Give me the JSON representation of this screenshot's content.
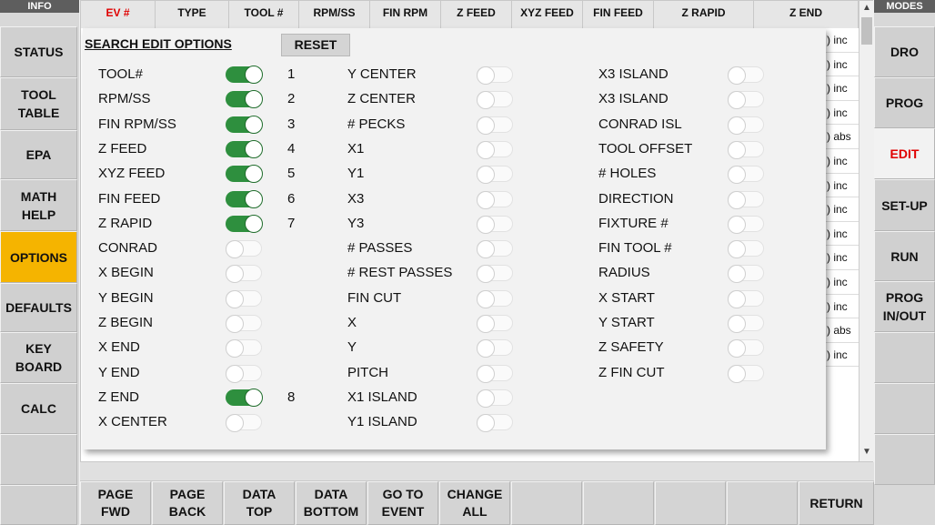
{
  "left_sidebar": {
    "header": "INFO",
    "buttons": [
      "STATUS",
      "TOOL\nTABLE",
      "EPA",
      "MATH\nHELP",
      "OPTIONS",
      "DEFAULTS",
      "KEY\nBOARD",
      "CALC",
      "",
      ""
    ],
    "active": "OPTIONS"
  },
  "right_sidebar": {
    "header": "MODES",
    "buttons": [
      "DRO",
      "PROG",
      "EDIT",
      "SET-UP",
      "RUN",
      "PROG\nIN/OUT",
      "",
      "",
      ""
    ],
    "active": "EDIT"
  },
  "table": {
    "headers": [
      "EV #",
      "TYPE",
      "TOOL #",
      "RPM/SS",
      "FIN\nRPM",
      "Z\nFEED",
      "XYZ\nFEED",
      "FIN\nFEED",
      "Z RAPID",
      "Z END"
    ],
    "z_end_col": [
      ") inc",
      ") inc",
      ") inc",
      ") inc",
      ") abs",
      ") inc",
      ") inc",
      ") inc",
      ") inc",
      ") inc",
      ") inc",
      ") inc",
      ") abs",
      ") inc"
    ]
  },
  "dialog": {
    "title": "SEARCH EDIT OPTIONS",
    "reset_label": "RESET",
    "columns": [
      [
        {
          "label": "TOOL#",
          "on": true,
          "order": "1"
        },
        {
          "label": "RPM/SS",
          "on": true,
          "order": "2"
        },
        {
          "label": "FIN RPM/SS",
          "on": true,
          "order": "3"
        },
        {
          "label": "Z FEED",
          "on": true,
          "order": "4"
        },
        {
          "label": "XYZ FEED",
          "on": true,
          "order": "5"
        },
        {
          "label": "FIN FEED",
          "on": true,
          "order": "6"
        },
        {
          "label": "Z RAPID",
          "on": true,
          "order": "7"
        },
        {
          "label": "CONRAD",
          "on": false,
          "order": ""
        },
        {
          "label": "X BEGIN",
          "on": false,
          "order": ""
        },
        {
          "label": "Y BEGIN",
          "on": false,
          "order": ""
        },
        {
          "label": "Z BEGIN",
          "on": false,
          "order": ""
        },
        {
          "label": "X END",
          "on": false,
          "order": ""
        },
        {
          "label": "Y END",
          "on": false,
          "order": ""
        },
        {
          "label": "Z END",
          "on": true,
          "order": "8"
        },
        {
          "label": "X CENTER",
          "on": false,
          "order": ""
        }
      ],
      [
        {
          "label": "Y CENTER",
          "on": false,
          "order": ""
        },
        {
          "label": "Z CENTER",
          "on": false,
          "order": ""
        },
        {
          "label": "# PECKS",
          "on": false,
          "order": ""
        },
        {
          "label": "X1",
          "on": false,
          "order": ""
        },
        {
          "label": "Y1",
          "on": false,
          "order": ""
        },
        {
          "label": "X3",
          "on": false,
          "order": ""
        },
        {
          "label": "Y3",
          "on": false,
          "order": ""
        },
        {
          "label": "# PASSES",
          "on": false,
          "order": ""
        },
        {
          "label": "# REST PASSES",
          "on": false,
          "order": ""
        },
        {
          "label": "FIN CUT",
          "on": false,
          "order": ""
        },
        {
          "label": "X",
          "on": false,
          "order": ""
        },
        {
          "label": "Y",
          "on": false,
          "order": ""
        },
        {
          "label": "PITCH",
          "on": false,
          "order": ""
        },
        {
          "label": "X1 ISLAND",
          "on": false,
          "order": ""
        },
        {
          "label": "Y1 ISLAND",
          "on": false,
          "order": ""
        }
      ],
      [
        {
          "label": "X3 ISLAND",
          "on": false,
          "order": ""
        },
        {
          "label": "X3 ISLAND",
          "on": false,
          "order": ""
        },
        {
          "label": "CONRAD ISL",
          "on": false,
          "order": ""
        },
        {
          "label": "TOOL OFFSET",
          "on": false,
          "order": ""
        },
        {
          "label": "# HOLES",
          "on": false,
          "order": ""
        },
        {
          "label": "DIRECTION",
          "on": false,
          "order": ""
        },
        {
          "label": "FIXTURE #",
          "on": false,
          "order": ""
        },
        {
          "label": "FIN TOOL #",
          "on": false,
          "order": ""
        },
        {
          "label": "RADIUS",
          "on": false,
          "order": ""
        },
        {
          "label": "X START",
          "on": false,
          "order": ""
        },
        {
          "label": "Y START",
          "on": false,
          "order": ""
        },
        {
          "label": "Z SAFETY",
          "on": false,
          "order": ""
        },
        {
          "label": "Z FIN CUT",
          "on": false,
          "order": ""
        }
      ]
    ],
    "colors": {
      "toggle_on": "#2e8f3e",
      "active_tab": "#f5b400",
      "edit_text": "#e00000"
    }
  },
  "bottom_toolbar": {
    "buttons": [
      "PAGE\nFWD",
      "PAGE\nBACK",
      "DATA\nTOP",
      "DATA\nBOTTOM",
      "GO TO\nEVENT",
      "CHANGE\nALL",
      "",
      "",
      "",
      "",
      "RETURN"
    ]
  },
  "icons": {
    "scroll_up": "chevron-up-icon",
    "scroll_down": "chevron-down-icon"
  }
}
